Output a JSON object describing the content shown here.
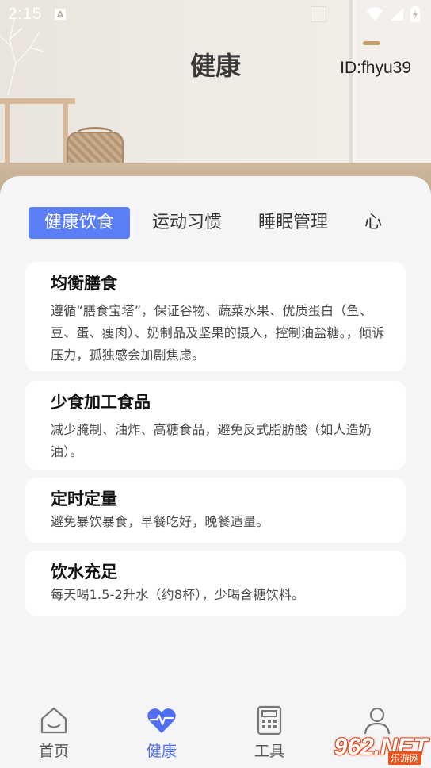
{
  "status_bar": {
    "time": "2:15",
    "notification_letter": "A"
  },
  "header": {
    "title": "健康",
    "user_id": "ID:fhyu39"
  },
  "tabs": [
    {
      "label": "健康饮食",
      "active": true
    },
    {
      "label": "运动习惯",
      "active": false
    },
    {
      "label": "睡眠管理",
      "active": false
    },
    {
      "label": "心",
      "active": false
    }
  ],
  "cards": [
    {
      "title": "均衡膳食",
      "body": "遵循“膳食宝塔”，保证谷物、蔬菜水果、优质蛋白（鱼、豆、蛋、瘦肉）、奶制品及坚果的摄入，控制油盐糖。，倾诉压力，孤独感会加剧焦虑。"
    },
    {
      "title": "少食加工食品",
      "body": "减少腌制、油炸、高糖食品，避免反式脂肪酸（如人造奶油）。"
    },
    {
      "title": "定时定量",
      "body": "避免暴饮暴食，早餐吃好，晚餐适量。"
    },
    {
      "title": "饮水充足",
      "body": "每天喝1.5-2升水（约8杯），少喝含糖饮料。"
    }
  ],
  "bottom_nav": [
    {
      "label": "首页",
      "icon": "home-icon",
      "active": false
    },
    {
      "label": "健康",
      "icon": "heart-pulse-icon",
      "active": true
    },
    {
      "label": "工具",
      "icon": "calculator-icon",
      "active": false
    },
    {
      "label": "我的",
      "icon": "user-icon",
      "active": false
    }
  ],
  "watermark": {
    "main": "962.NET",
    "sub": "乐游网"
  },
  "colors": {
    "accent": "#5b7df5",
    "nav_active": "#4f6ef2",
    "sheet_bg": "#f5f5f7",
    "card_bg": "#ffffff"
  }
}
